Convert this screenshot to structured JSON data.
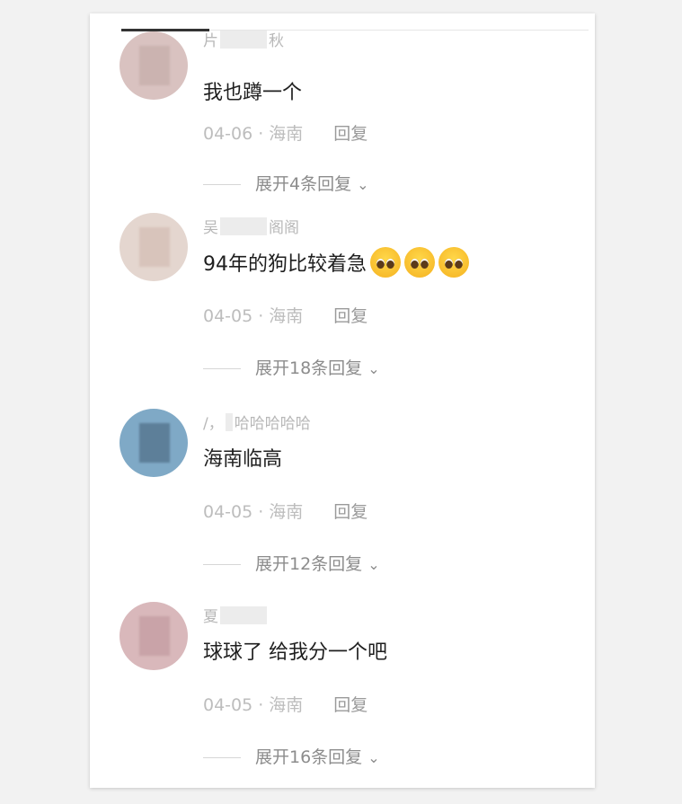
{
  "comments": [
    {
      "username_prefix": "片",
      "username_suffix": "秋",
      "text": "我也蹲一个",
      "emojis": [],
      "date": "04-06",
      "location": "海南",
      "reply_label": "回复",
      "expand_label": "展开4条回复",
      "avatar_color": "#d7b9b6"
    },
    {
      "username_prefix": "吴",
      "username_suffix": "阁阁",
      "text": "94年的狗比较着急",
      "emojis": [
        "pleading-face-icon",
        "pleading-face-icon",
        "pleading-face-icon"
      ],
      "date": "04-05",
      "location": "海南",
      "reply_label": "回复",
      "expand_label": "展开18条回复",
      "avatar_color": "#e4d6cf"
    },
    {
      "username_prefix": "/，",
      "username_suffix": "哈哈哈哈哈",
      "text": "海南临高",
      "emojis": [],
      "date": "04-05",
      "location": "海南",
      "reply_label": "回复",
      "expand_label": "展开12条回复",
      "avatar_color": "#7fa9c6"
    },
    {
      "username_prefix": "夏",
      "username_suffix": "",
      "text": "球球了  给我分一个吧",
      "emojis": [],
      "date": "04-05",
      "location": "海南",
      "reply_label": "回复",
      "expand_label": "展开16条回复",
      "avatar_color": "#d9b8bb"
    }
  ],
  "separator": "·",
  "chevron_icon": "chevron-down-icon"
}
